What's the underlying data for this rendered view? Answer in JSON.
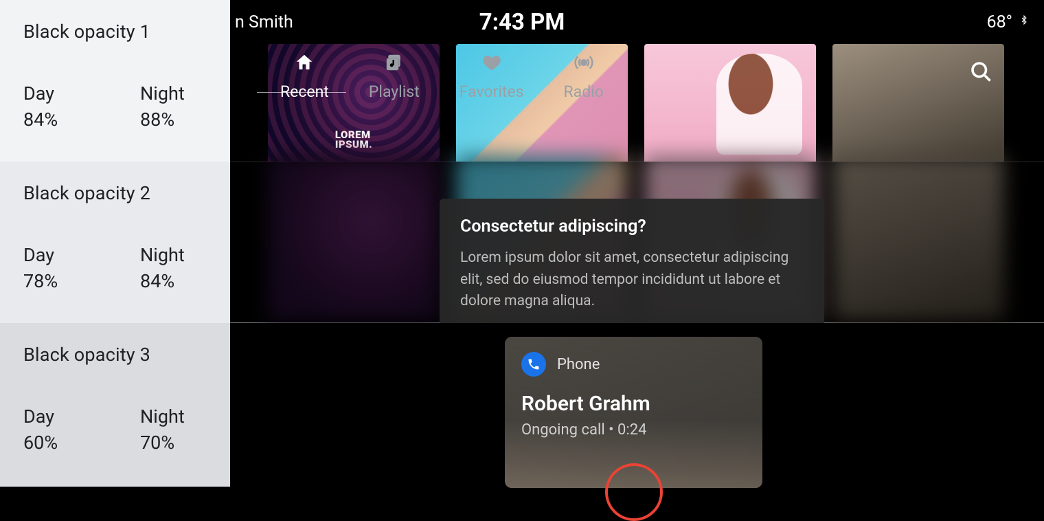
{
  "sidebar": {
    "sections": [
      {
        "title": "Black opacity 1",
        "day_label": "Day",
        "day_value": "84%",
        "night_label": "Night",
        "night_value": "88%"
      },
      {
        "title": "Black opacity 2",
        "day_label": "Day",
        "day_value": "78%",
        "night_label": "Night",
        "night_value": "84%"
      },
      {
        "title": "Black opacity 3",
        "day_label": "Day",
        "day_value": "60%",
        "night_label": "Night",
        "night_value": "70%"
      }
    ]
  },
  "statusbar": {
    "user_fragment": "n Smith",
    "clock": "7:43 PM",
    "temperature": "68°"
  },
  "tabs": [
    {
      "label": "Recent",
      "icon": "home-icon",
      "active": true
    },
    {
      "label": "Playlist",
      "icon": "playlist-icon",
      "active": false
    },
    {
      "label": "Favorites",
      "icon": "heart-icon",
      "active": false
    },
    {
      "label": "Radio",
      "icon": "radio-icon",
      "active": false
    }
  ],
  "tiles": {
    "item1_logo_line1": "LOREM",
    "item1_logo_line2": "IPSUM."
  },
  "tooltip": {
    "title": "Consectetur adipiscing?",
    "body": "Lorem ipsum dolor sit amet, consectetur adipiscing elit, sed do eiusmod tempor incididunt ut labore et dolore magna aliqua."
  },
  "phone_card": {
    "app_name": "Phone",
    "caller": "Robert Grahm",
    "status": "Ongoing call • 0:24"
  }
}
